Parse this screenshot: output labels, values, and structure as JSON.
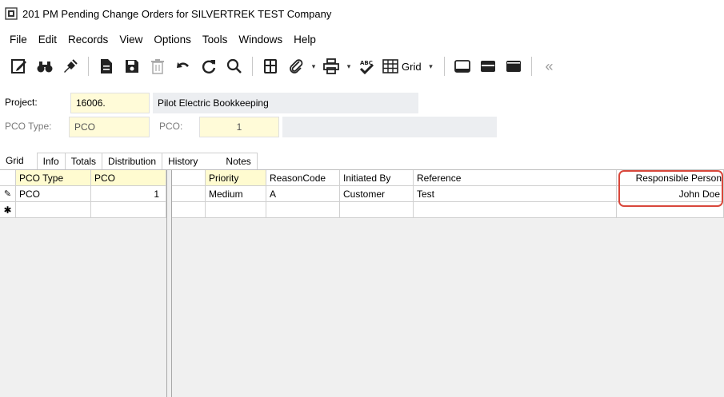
{
  "window": {
    "title": "201 PM Pending Change Orders for SILVERTREK TEST Company"
  },
  "menu": [
    "File",
    "Edit",
    "Records",
    "View",
    "Options",
    "Tools",
    "Windows",
    "Help"
  ],
  "toolbar": {
    "icons": [
      "edit-icon",
      "binoculars-icon",
      "launch-icon",
      "document-icon",
      "save-icon",
      "delete-icon",
      "undo-icon",
      "refresh-icon",
      "search-icon",
      "calculator-icon",
      "attachment-icon",
      "print-icon",
      "spellcheck-icon",
      "grid-icon",
      "panel-bottom-icon",
      "panel-split-icon",
      "panel-top-icon",
      "collapse-icon"
    ],
    "grid_label": "Grid"
  },
  "form": {
    "project_label": "Project:",
    "project_value": "16006.",
    "project_desc": "Pilot Electric Bookkeeping",
    "pco_type_label": "PCO Type:",
    "pco_type_value": "PCO",
    "pco_label": "PCO:",
    "pco_value": "1",
    "pco_desc": ""
  },
  "tabs": [
    "Grid",
    "Info",
    "Totals",
    "Distribution",
    "History",
    "Notes"
  ],
  "grid": {
    "left_headers": [
      "PCO Type",
      "PCO"
    ],
    "left_rows": [
      [
        "PCO",
        "1"
      ]
    ],
    "right_headers": [
      "",
      "Priority",
      "ReasonCode",
      "Initiated By",
      "Reference",
      "",
      "Responsible Person"
    ],
    "right_rows": [
      [
        "",
        "Medium",
        "A",
        "Customer",
        "Test",
        "",
        "John Doe"
      ]
    ],
    "edit_row_marker": "✎",
    "new_row_marker": "✱"
  },
  "colors": {
    "key_field_bg": "#fffbd0",
    "highlight": "#d9473b"
  }
}
